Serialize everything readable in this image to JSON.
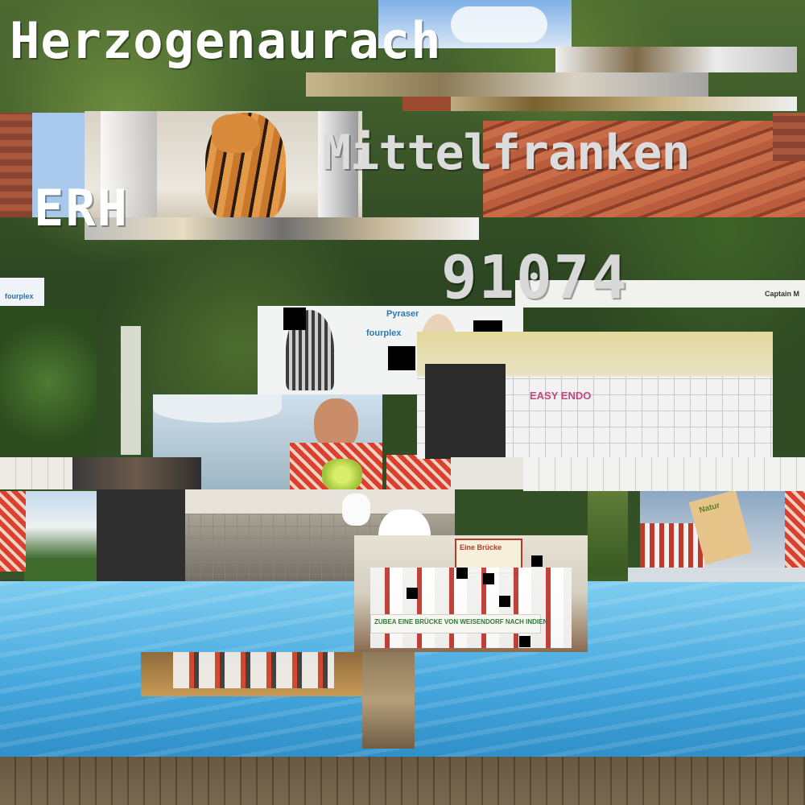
{
  "overlay": {
    "town": "Herzogenaurach",
    "region": "Mittelfranken",
    "plate": "ERH",
    "postcode": "91074"
  },
  "signs": {
    "sponsor_left": "fourplex",
    "sponsor_mid_1": "Pyraser",
    "sponsor_mid_2": "fourplex",
    "sponsor_right_1": "Captain M",
    "nature_bag": "Natur",
    "graffiti": "EASY ENDO"
  },
  "banner": {
    "text": "ZUBEA EINE BRÜCKE VON WEISENDORF NACH INDIEN",
    "sign_top": "Eine Brücke"
  },
  "colors": {
    "pool_water": "#5fb9e4",
    "foliage": "#2f4a24",
    "sky": "#9cc7ee",
    "tile_wall": "#eae6dc",
    "brick_roof": "#b85d3a"
  }
}
